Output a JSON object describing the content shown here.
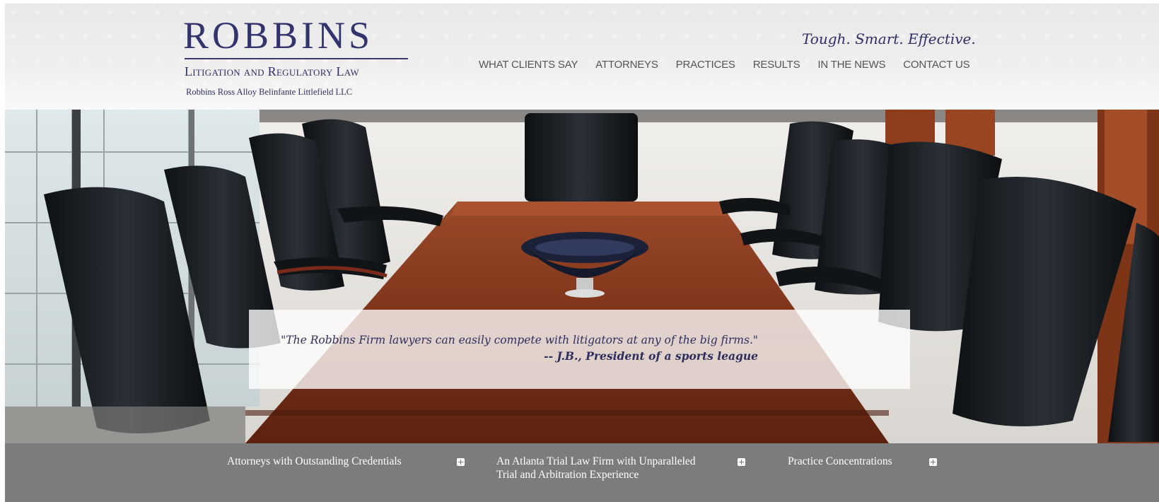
{
  "logo": {
    "name": "ROBBINS",
    "tagline": "Litigation and Regulatory Law",
    "firm_full_name": "Robbins Ross Alloy Belinfante Littlefield LLC"
  },
  "header": {
    "slogan": "Tough. Smart. Effective."
  },
  "nav": {
    "items": [
      "WHAT CLIENTS SAY",
      "ATTORNEYS",
      "PRACTICES",
      "RESULTS",
      "IN THE NEWS",
      "CONTACT US"
    ]
  },
  "hero": {
    "quote": "\"The Robbins Firm lawyers can easily compete with litigators at any of the big firms.\"",
    "attribution": "-- J.B., President of a sports league"
  },
  "features": {
    "items": [
      {
        "label": "Attorneys with Outstanding Credentials",
        "icon": "plus-icon"
      },
      {
        "label": "An Atlanta Trial Law Firm with Unparalleled Trial and Arbitration Experience",
        "icon": "plus-icon"
      },
      {
        "label": "Practice Concentrations",
        "icon": "plus-icon"
      }
    ]
  },
  "colors": {
    "brand_navy": "#33336e",
    "nav_text": "#555555",
    "bottom_bar": "#7c7c7c",
    "table_wood": "#8b3a1e"
  }
}
